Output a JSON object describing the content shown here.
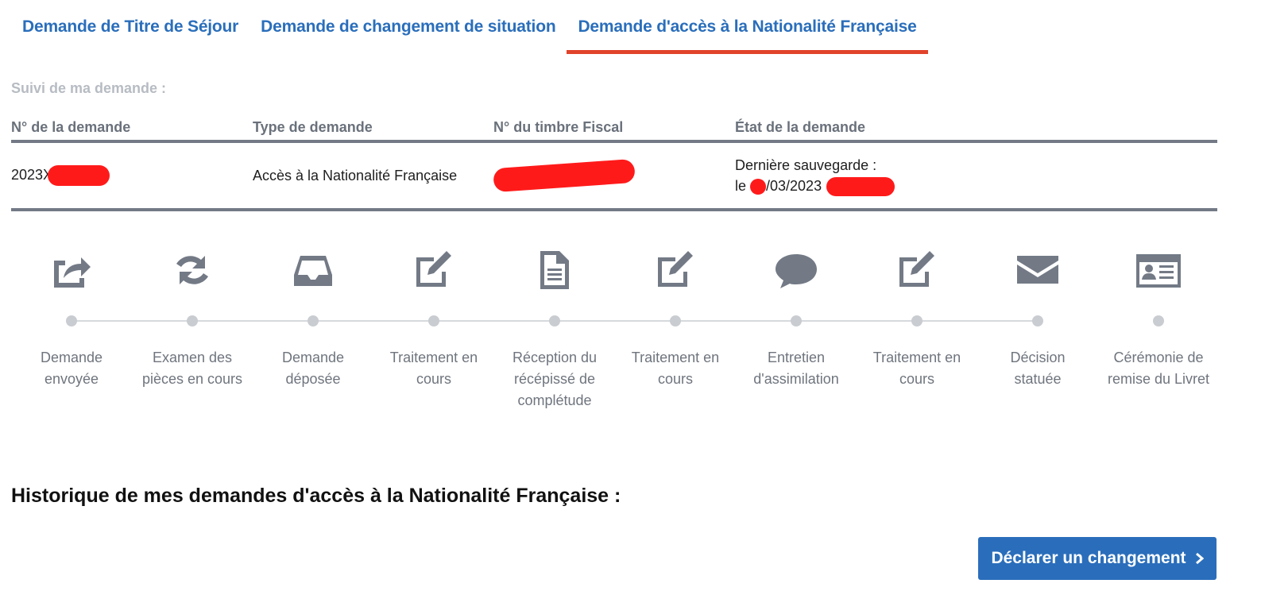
{
  "tabs": [
    {
      "label": "Demande de Titre de Séjour"
    },
    {
      "label": "Demande de changement de situation"
    },
    {
      "label": "Demande d'accès à la Nationalité Française",
      "active": true
    }
  ],
  "tracking": {
    "title": "Suivi de ma demande :",
    "columns": [
      "N° de la demande",
      "Type de demande",
      "N° du timbre Fiscal",
      "État de la demande"
    ],
    "row": {
      "request_number": "2023X",
      "request_type": "Accès à la Nationalité Française",
      "state_line1": "Dernière sauvegarde :",
      "state_prefix": "le ",
      "state_date": "/03/2023"
    }
  },
  "steps": [
    {
      "icon": "share-icon",
      "label": "Demande envoyée"
    },
    {
      "icon": "refresh-icon",
      "label": "Examen des pièces en cours"
    },
    {
      "icon": "inbox-icon",
      "label": "Demande déposée"
    },
    {
      "icon": "edit-icon",
      "label": "Traitement en cours"
    },
    {
      "icon": "document-icon",
      "label": "Réception du récépissé de complétude"
    },
    {
      "icon": "edit-icon",
      "label": "Traitement en cours"
    },
    {
      "icon": "speech-bubble-icon",
      "label": "Entretien d'assimilation"
    },
    {
      "icon": "edit-icon",
      "label": "Traitement en cours"
    },
    {
      "icon": "envelope-icon",
      "label": "Décision statuée"
    },
    {
      "icon": "id-card-icon",
      "label": "Cérémonie de remise du Livret"
    }
  ],
  "history": {
    "title": "Historique de mes demandes d'accès à la Nationalité Française :"
  },
  "actions": {
    "declare_change": "Déclarer un changement"
  },
  "colors": {
    "accent": "#2a6ebb",
    "tab_underline": "#e0432b",
    "icon": "#737a86"
  }
}
